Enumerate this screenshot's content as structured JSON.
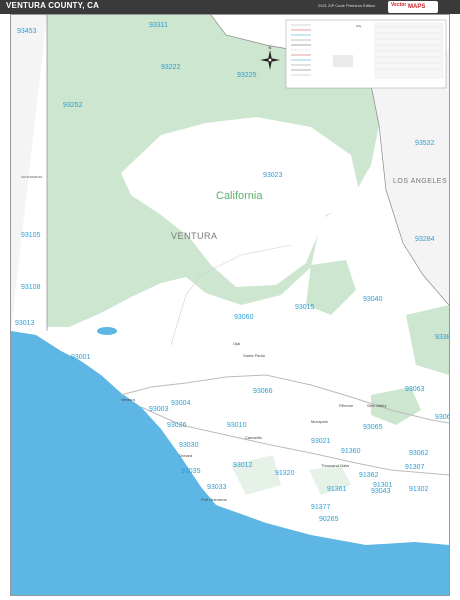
{
  "header": {
    "title": "VENTURA COUNTY, CA",
    "edition": "2021 ZIP Code Premium Edition"
  },
  "logo": {
    "line1": "Vector",
    "line2": "MAPS"
  },
  "labels": {
    "county": "VENTURA",
    "forest": "California",
    "neighbor_county": "LOS ANGELES",
    "santa_barbara": "SANTA BARBARA",
    "legend_city": "City"
  },
  "zips": [
    "93453",
    "93311",
    "93222",
    "93225",
    "93252",
    "93532",
    "93023",
    "93105",
    "93284",
    "93108",
    "93040",
    "93015",
    "93060",
    "93013",
    "93381",
    "93001",
    "93066",
    "93063",
    "93004",
    "93003",
    "93036",
    "93010",
    "93030",
    "93012",
    "93065",
    "93035",
    "93033",
    "93021",
    "93062",
    "93064",
    "91360",
    "91307",
    "91361",
    "91362",
    "91320",
    "93043",
    "91301",
    "91302",
    "91377",
    "90265"
  ],
  "cities": [
    "Ventura",
    "Oxnard",
    "Fillmore",
    "Santa Paula",
    "Camarillo",
    "Moorpark",
    "Simi Valley",
    "Thousand Oaks",
    "Ojai",
    "Port Hueneme"
  ],
  "icons": {
    "compass": "compass-rose-icon",
    "logo": "vector-maps-logo"
  },
  "colors": {
    "ocean": "#5eb6e4",
    "forest": "#cce6cf",
    "land": "#ffffff",
    "neighbor_land": "#f3f3f3",
    "zip_label": "#2a9fd6",
    "header": "#3a3a3a"
  }
}
